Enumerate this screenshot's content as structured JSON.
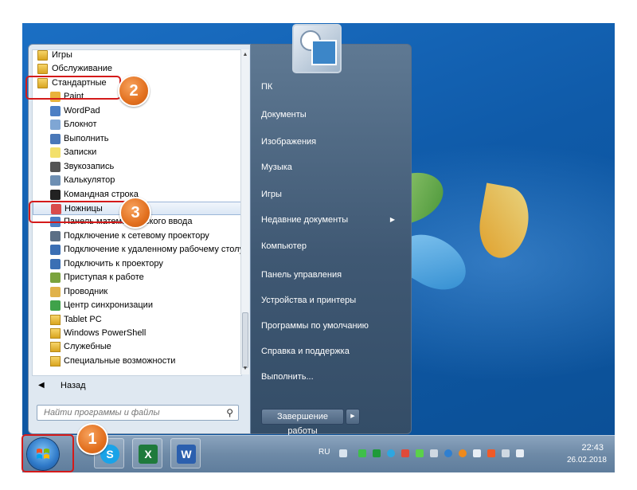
{
  "program_list": {
    "items": [
      {
        "label": "Игры",
        "kind": "folder",
        "icon": "folder-icon"
      },
      {
        "label": "Обслуживание",
        "kind": "folder",
        "icon": "folder-icon"
      },
      {
        "label": "Стандартные",
        "kind": "folder",
        "icon": "folder-icon"
      },
      {
        "label": "Paint",
        "kind": "sub",
        "icon": "paint-icon"
      },
      {
        "label": "WordPad",
        "kind": "sub",
        "icon": "wordpad-icon"
      },
      {
        "label": "Блокнот",
        "kind": "sub",
        "icon": "notepad-icon"
      },
      {
        "label": "Выполнить",
        "kind": "sub",
        "icon": "run-icon"
      },
      {
        "label": "Записки",
        "kind": "sub",
        "icon": "sticky-notes-icon"
      },
      {
        "label": "Звукозапись",
        "kind": "sub",
        "icon": "microphone-icon"
      },
      {
        "label": "Калькулятор",
        "kind": "sub",
        "icon": "calculator-icon"
      },
      {
        "label": "Командная строка",
        "kind": "sub",
        "icon": "command-prompt-icon"
      },
      {
        "label": "Ножницы",
        "kind": "sub",
        "icon": "scissors-icon",
        "highlighted": true
      },
      {
        "label": "Панель математического ввода",
        "kind": "sub",
        "icon": "math-input-icon"
      },
      {
        "label": "Подключение к сетевому проектору",
        "kind": "sub",
        "icon": "network-projector-icon"
      },
      {
        "label": "Подключение к удаленному рабочему столу",
        "kind": "sub",
        "icon": "remote-desktop-icon"
      },
      {
        "label": "Подключить к проектору",
        "kind": "sub",
        "icon": "projector-icon"
      },
      {
        "label": "Приступая к работе",
        "kind": "sub",
        "icon": "getting-started-icon"
      },
      {
        "label": "Проводник",
        "kind": "sub",
        "icon": "explorer-icon"
      },
      {
        "label": "Центр синхронизации",
        "kind": "sub",
        "icon": "sync-center-icon"
      },
      {
        "label": "Tablet PC",
        "kind": "sub",
        "icon": "folder-icon"
      },
      {
        "label": "Windows PowerShell",
        "kind": "sub",
        "icon": "folder-icon"
      },
      {
        "label": "Служебные",
        "kind": "sub",
        "icon": "folder-icon"
      },
      {
        "label": "Специальные возможности",
        "kind": "sub",
        "icon": "folder-icon"
      }
    ]
  },
  "back_label": "Назад",
  "search_placeholder": "Найти программы и файлы",
  "right_pane": [
    {
      "label": "ПК",
      "arrow": false
    },
    {
      "label": "Документы",
      "arrow": false
    },
    {
      "label": "Изображения",
      "arrow": false
    },
    {
      "label": "Музыка",
      "arrow": false
    },
    {
      "label": "Игры",
      "arrow": false
    },
    {
      "label": "Недавние документы",
      "arrow": true
    },
    {
      "label": "Компьютер",
      "arrow": false
    },
    {
      "label": "Панель управления",
      "arrow": false
    },
    {
      "label": "Устройства и принтеры",
      "arrow": false
    },
    {
      "label": "Программы по умолчанию",
      "arrow": false
    },
    {
      "label": "Справка и поддержка",
      "arrow": false
    },
    {
      "label": "Выполнить...",
      "arrow": false
    }
  ],
  "shutdown_label": "Завершение работы",
  "taskbar": {
    "apps": [
      {
        "name": "skype-icon",
        "glyph": "S",
        "color": "#1aa3e8"
      },
      {
        "name": "excel-icon",
        "glyph": "X",
        "color": "#1f7a3c"
      },
      {
        "name": "word-icon",
        "glyph": "W",
        "color": "#2b5fae"
      }
    ],
    "lang": "RU",
    "time": "22:43",
    "date": "26.02.2018"
  },
  "callouts": [
    "1",
    "2",
    "3"
  ],
  "colors": {
    "callout": "#e2701f",
    "frame": "#d41a1a",
    "highlight": "#dbe7f5"
  }
}
